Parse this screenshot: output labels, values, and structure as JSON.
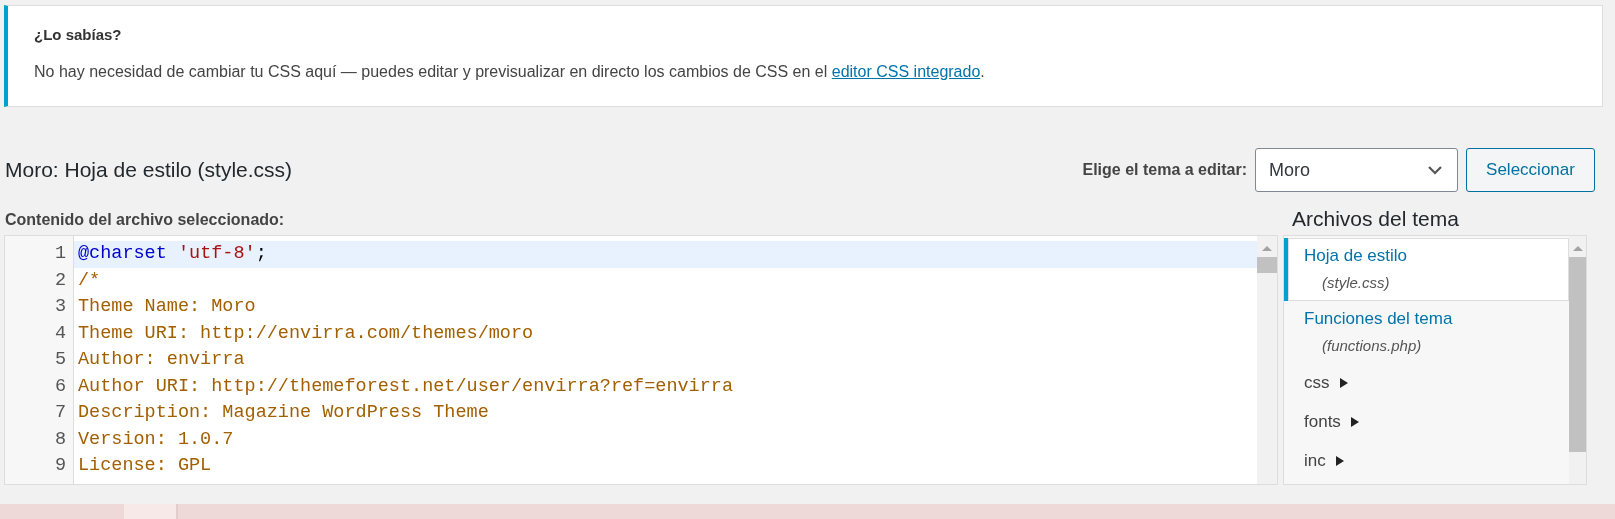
{
  "notice": {
    "title": "¿Lo sabías?",
    "text": "No hay necesidad de cambiar tu CSS aquí — puedes editar y previsualizar en directo los cambios de CSS en el ",
    "link": "editor CSS integrado",
    "after": "."
  },
  "page_title": "Moro: Hoja de estilo (style.css)",
  "theme_picker": {
    "label": "Elige el tema a editar:",
    "value": "Moro",
    "button": "Seleccionar"
  },
  "editor": {
    "label": "Contenido del archivo seleccionado:",
    "lines": [
      {
        "number": "1",
        "active": true,
        "tokens": [
          {
            "kind": "def",
            "text": "@charset "
          },
          {
            "kind": "string",
            "text": "'utf-8'"
          },
          {
            "kind": "plain",
            "text": ";"
          }
        ]
      },
      {
        "number": "2",
        "active": false,
        "tokens": [
          {
            "kind": "comment",
            "text": "/*"
          }
        ]
      },
      {
        "number": "3",
        "active": false,
        "tokens": [
          {
            "kind": "comment",
            "text": "Theme Name: Moro"
          }
        ]
      },
      {
        "number": "4",
        "active": false,
        "tokens": [
          {
            "kind": "comment",
            "text": "Theme URI: http://envirra.com/themes/moro"
          }
        ]
      },
      {
        "number": "5",
        "active": false,
        "tokens": [
          {
            "kind": "comment",
            "text": "Author: envirra"
          }
        ]
      },
      {
        "number": "6",
        "active": false,
        "tokens": [
          {
            "kind": "comment",
            "text": "Author URI: http://themeforest.net/user/envirra?ref=envirra"
          }
        ]
      },
      {
        "number": "7",
        "active": false,
        "tokens": [
          {
            "kind": "comment",
            "text": "Description: Magazine WordPress Theme"
          }
        ]
      },
      {
        "number": "8",
        "active": false,
        "tokens": [
          {
            "kind": "comment",
            "text": "Version: 1.0.7"
          }
        ]
      },
      {
        "number": "9",
        "active": false,
        "tokens": [
          {
            "kind": "comment",
            "text": "License: GPL"
          }
        ]
      }
    ]
  },
  "files": {
    "title": "Archivos del tema",
    "items": [
      {
        "kind": "file",
        "label": "Hoja de estilo",
        "filename": "(style.css)",
        "selected": true
      },
      {
        "kind": "file",
        "label": "Funciones del tema",
        "filename": "(functions.php)",
        "selected": false
      },
      {
        "kind": "folder",
        "label": "css",
        "expanded": false
      },
      {
        "kind": "folder",
        "label": "fonts",
        "expanded": false
      },
      {
        "kind": "folder",
        "label": "inc",
        "expanded": false
      }
    ]
  }
}
